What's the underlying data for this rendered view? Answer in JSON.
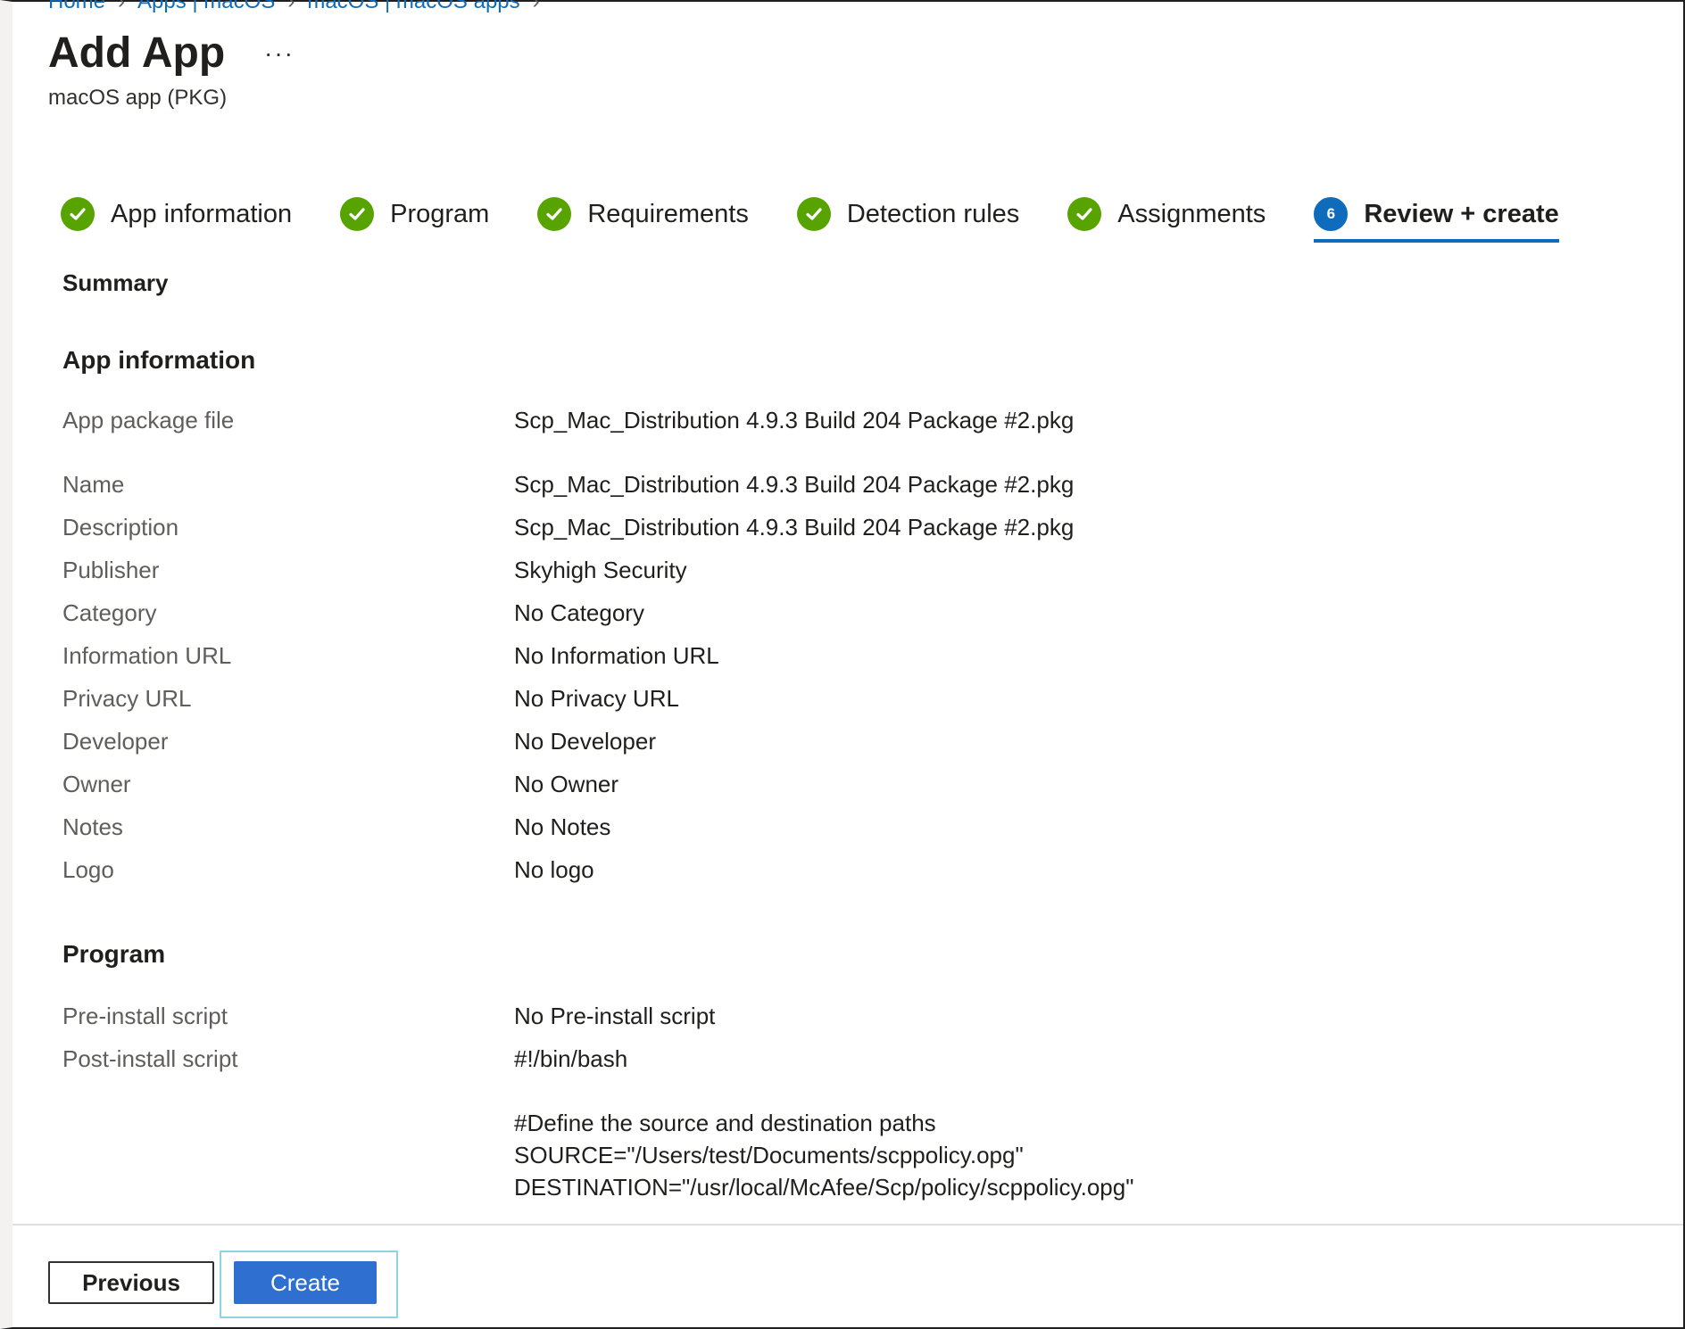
{
  "breadcrumb": [
    "Home",
    "Apps | macOS",
    "macOS | macOS apps"
  ],
  "header": {
    "title": "Add App",
    "more_label": "···",
    "subtitle": "macOS app (PKG)"
  },
  "steps": [
    {
      "label": "App information",
      "status": "complete"
    },
    {
      "label": "Program",
      "status": "complete"
    },
    {
      "label": "Requirements",
      "status": "complete"
    },
    {
      "label": "Detection rules",
      "status": "complete"
    },
    {
      "label": "Assignments",
      "status": "complete"
    },
    {
      "label": "Review + create",
      "status": "current",
      "number": "6"
    }
  ],
  "summary_label": "Summary",
  "app_information": {
    "heading": "App information",
    "rows": [
      {
        "label": "App package file",
        "value": "Scp_Mac_Distribution 4.9.3 Build 204 Package #2.pkg"
      },
      {
        "label": "Name",
        "value": "Scp_Mac_Distribution 4.9.3 Build 204 Package #2.pkg"
      },
      {
        "label": "Description",
        "value": "Scp_Mac_Distribution 4.9.3 Build 204 Package #2.pkg"
      },
      {
        "label": "Publisher",
        "value": "Skyhigh Security"
      },
      {
        "label": "Category",
        "value": "No Category"
      },
      {
        "label": "Information URL",
        "value": "No Information URL"
      },
      {
        "label": "Privacy URL",
        "value": "No Privacy URL"
      },
      {
        "label": "Developer",
        "value": "No Developer"
      },
      {
        "label": "Owner",
        "value": "No Owner"
      },
      {
        "label": "Notes",
        "value": "No Notes"
      },
      {
        "label": "Logo",
        "value": "No logo"
      }
    ]
  },
  "program": {
    "heading": "Program",
    "rows": [
      {
        "label": "Pre-install script",
        "value": "No Pre-install script"
      },
      {
        "label": "Post-install script",
        "value": "#!/bin/bash"
      }
    ],
    "script_lines": [
      "#Define the source and destination paths",
      "SOURCE=\"/Users/test/Documents/scppolicy.opg\"",
      "DESTINATION=\"/usr/local/McAfee/Scp/policy/scppolicy.opg\""
    ]
  },
  "footer": {
    "previous_label": "Previous",
    "create_label": "Create"
  },
  "colors": {
    "accent": "#0f6cbd",
    "complete": "#57a300",
    "create_button": "#2f6fd0"
  }
}
